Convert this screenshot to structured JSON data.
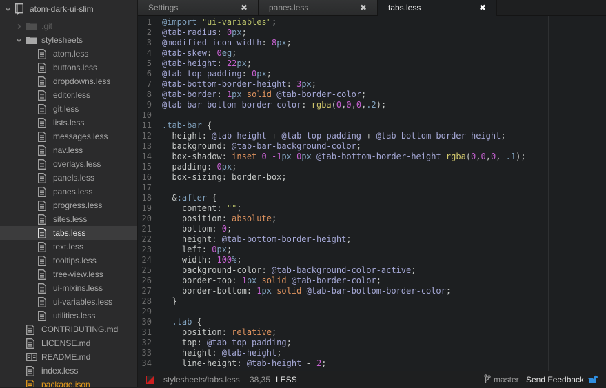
{
  "sidebar": {
    "root": {
      "label": "atom-dark-ui-slim",
      "icon": "repo-icon",
      "expanded": true
    },
    "items": [
      {
        "label": ".git",
        "type": "folder",
        "depth": 1,
        "expanded": false,
        "dim": true
      },
      {
        "label": "stylesheets",
        "type": "folder",
        "depth": 1,
        "expanded": true
      },
      {
        "label": "atom.less",
        "type": "file",
        "depth": 2
      },
      {
        "label": "buttons.less",
        "type": "file",
        "depth": 2
      },
      {
        "label": "dropdowns.less",
        "type": "file",
        "depth": 2
      },
      {
        "label": "editor.less",
        "type": "file",
        "depth": 2
      },
      {
        "label": "git.less",
        "type": "file",
        "depth": 2
      },
      {
        "label": "lists.less",
        "type": "file",
        "depth": 2
      },
      {
        "label": "messages.less",
        "type": "file",
        "depth": 2
      },
      {
        "label": "nav.less",
        "type": "file",
        "depth": 2
      },
      {
        "label": "overlays.less",
        "type": "file",
        "depth": 2
      },
      {
        "label": "panels.less",
        "type": "file",
        "depth": 2
      },
      {
        "label": "panes.less",
        "type": "file",
        "depth": 2
      },
      {
        "label": "progress.less",
        "type": "file",
        "depth": 2
      },
      {
        "label": "sites.less",
        "type": "file",
        "depth": 2
      },
      {
        "label": "tabs.less",
        "type": "file",
        "depth": 2,
        "selected": true
      },
      {
        "label": "text.less",
        "type": "file",
        "depth": 2
      },
      {
        "label": "tooltips.less",
        "type": "file",
        "depth": 2
      },
      {
        "label": "tree-view.less",
        "type": "file",
        "depth": 2
      },
      {
        "label": "ui-mixins.less",
        "type": "file",
        "depth": 2
      },
      {
        "label": "ui-variables.less",
        "type": "file",
        "depth": 2
      },
      {
        "label": "utilities.less",
        "type": "file",
        "depth": 2
      },
      {
        "label": "CONTRIBUTING.md",
        "type": "file",
        "depth": 1
      },
      {
        "label": "LICENSE.md",
        "type": "file",
        "depth": 1
      },
      {
        "label": "README.md",
        "type": "book",
        "depth": 1
      },
      {
        "label": "index.less",
        "type": "file",
        "depth": 1
      },
      {
        "label": "package.json",
        "type": "file-modified",
        "depth": 1
      }
    ]
  },
  "tabs": [
    {
      "label": "Settings",
      "close": "✖",
      "active": false
    },
    {
      "label": "panes.less",
      "close": "✖",
      "active": false
    },
    {
      "label": "tabs.less",
      "close": "✖",
      "active": true
    }
  ],
  "editor": {
    "lines": [
      {
        "n": "1",
        "tokens": [
          [
            "imp",
            "@import"
          ],
          [
            "txt",
            " "
          ],
          [
            "str",
            "\"ui-variables\""
          ],
          [
            "txt",
            ";"
          ]
        ]
      },
      {
        "n": "2",
        "tokens": [
          [
            "var",
            "@tab-radius"
          ],
          [
            "txt",
            ": "
          ],
          [
            "num",
            "0"
          ],
          [
            "unit",
            "px"
          ],
          [
            "txt",
            ";"
          ]
        ]
      },
      {
        "n": "3",
        "tokens": [
          [
            "var",
            "@modified-icon-width"
          ],
          [
            "txt",
            ": "
          ],
          [
            "num",
            "8"
          ],
          [
            "unit",
            "px"
          ],
          [
            "txt",
            ";"
          ]
        ]
      },
      {
        "n": "4",
        "tokens": [
          [
            "var",
            "@tab-skew"
          ],
          [
            "txt",
            ": "
          ],
          [
            "num",
            "0"
          ],
          [
            "unit",
            "eg"
          ],
          [
            "txt",
            ";"
          ]
        ]
      },
      {
        "n": "5",
        "tokens": [
          [
            "var",
            "@tab-height"
          ],
          [
            "txt",
            ": "
          ],
          [
            "num",
            "22"
          ],
          [
            "unit",
            "px"
          ],
          [
            "txt",
            ";"
          ]
        ]
      },
      {
        "n": "6",
        "tokens": [
          [
            "var",
            "@tab-top-padding"
          ],
          [
            "txt",
            ": "
          ],
          [
            "num",
            "0"
          ],
          [
            "unit",
            "px"
          ],
          [
            "txt",
            ";"
          ]
        ]
      },
      {
        "n": "7",
        "tokens": [
          [
            "var",
            "@tab-bottom-border-height"
          ],
          [
            "txt",
            ": "
          ],
          [
            "num",
            "3"
          ],
          [
            "unit",
            "px"
          ],
          [
            "txt",
            ";"
          ]
        ]
      },
      {
        "n": "8",
        "tokens": [
          [
            "var",
            "@tab-border"
          ],
          [
            "txt",
            ": "
          ],
          [
            "num",
            "1"
          ],
          [
            "unit",
            "px"
          ],
          [
            "txt",
            " "
          ],
          [
            "kw",
            "solid"
          ],
          [
            "txt",
            " "
          ],
          [
            "var",
            "@tab-border-color"
          ],
          [
            "txt",
            ";"
          ]
        ]
      },
      {
        "n": "9",
        "tokens": [
          [
            "var",
            "@tab-bar-bottom-border-color"
          ],
          [
            "txt",
            ": "
          ],
          [
            "fn",
            "rgba"
          ],
          [
            "txt",
            "("
          ],
          [
            "num",
            "0"
          ],
          [
            "txt",
            ","
          ],
          [
            "num",
            "0"
          ],
          [
            "txt",
            ","
          ],
          [
            "num",
            "0"
          ],
          [
            "txt",
            ","
          ],
          [
            "unit",
            ".2"
          ],
          [
            "txt",
            ");"
          ]
        ]
      },
      {
        "n": "10",
        "tokens": []
      },
      {
        "n": "11",
        "tokens": [
          [
            "sel",
            ".tab-bar"
          ],
          [
            "txt",
            " {"
          ]
        ]
      },
      {
        "n": "12",
        "tokens": [
          [
            "txt",
            "  height: "
          ],
          [
            "var",
            "@tab-height"
          ],
          [
            "txt",
            " + "
          ],
          [
            "var",
            "@tab-top-padding"
          ],
          [
            "txt",
            " + "
          ],
          [
            "var",
            "@tab-bottom-border-height"
          ],
          [
            "txt",
            ";"
          ]
        ]
      },
      {
        "n": "13",
        "tokens": [
          [
            "txt",
            "  background: "
          ],
          [
            "var",
            "@tab-bar-background-color"
          ],
          [
            "txt",
            ";"
          ]
        ]
      },
      {
        "n": "14",
        "tokens": [
          [
            "txt",
            "  box-shadow: "
          ],
          [
            "kw",
            "inset"
          ],
          [
            "txt",
            " "
          ],
          [
            "num",
            "0"
          ],
          [
            "txt",
            " "
          ],
          [
            "num",
            "-1"
          ],
          [
            "unit",
            "px"
          ],
          [
            "txt",
            " "
          ],
          [
            "num",
            "0"
          ],
          [
            "unit",
            "px"
          ],
          [
            "txt",
            " "
          ],
          [
            "var",
            "@tab-bottom-border-height"
          ],
          [
            "txt",
            " "
          ],
          [
            "fn",
            "rgba"
          ],
          [
            "txt",
            "("
          ],
          [
            "num",
            "0"
          ],
          [
            "txt",
            ","
          ],
          [
            "num",
            "0"
          ],
          [
            "txt",
            ","
          ],
          [
            "num",
            "0"
          ],
          [
            "txt",
            ", "
          ],
          [
            "unit",
            ".1"
          ],
          [
            "txt",
            ");"
          ]
        ]
      },
      {
        "n": "15",
        "tokens": [
          [
            "txt",
            "  padding: "
          ],
          [
            "num",
            "0"
          ],
          [
            "unit",
            "px"
          ],
          [
            "txt",
            ";"
          ]
        ]
      },
      {
        "n": "16",
        "tokens": [
          [
            "txt",
            "  box-sizing: border-box;"
          ]
        ]
      },
      {
        "n": "17",
        "tokens": []
      },
      {
        "n": "18",
        "tokens": [
          [
            "txt",
            "  &"
          ],
          [
            "sel",
            ":after"
          ],
          [
            "txt",
            " {"
          ]
        ]
      },
      {
        "n": "19",
        "tokens": [
          [
            "txt",
            "    content: "
          ],
          [
            "str",
            "\"\""
          ],
          [
            "txt",
            ";"
          ]
        ]
      },
      {
        "n": "20",
        "tokens": [
          [
            "txt",
            "    position: "
          ],
          [
            "kw",
            "absolute"
          ],
          [
            "txt",
            ";"
          ]
        ]
      },
      {
        "n": "21",
        "tokens": [
          [
            "txt",
            "    bottom: "
          ],
          [
            "num",
            "0"
          ],
          [
            "txt",
            ";"
          ]
        ]
      },
      {
        "n": "22",
        "tokens": [
          [
            "txt",
            "    height: "
          ],
          [
            "var",
            "@tab-bottom-border-height"
          ],
          [
            "txt",
            ";"
          ]
        ]
      },
      {
        "n": "23",
        "tokens": [
          [
            "txt",
            "    left: "
          ],
          [
            "num",
            "0"
          ],
          [
            "unit",
            "px"
          ],
          [
            "txt",
            ";"
          ]
        ]
      },
      {
        "n": "24",
        "tokens": [
          [
            "txt",
            "    width: "
          ],
          [
            "num",
            "100"
          ],
          [
            "unit",
            "%"
          ],
          [
            "txt",
            ";"
          ]
        ]
      },
      {
        "n": "25",
        "tokens": [
          [
            "txt",
            "    background-color: "
          ],
          [
            "var",
            "@tab-background-color-active"
          ],
          [
            "txt",
            ";"
          ]
        ]
      },
      {
        "n": "26",
        "tokens": [
          [
            "txt",
            "    border-top: "
          ],
          [
            "num",
            "1"
          ],
          [
            "unit",
            "px"
          ],
          [
            "txt",
            " "
          ],
          [
            "kw",
            "solid"
          ],
          [
            "txt",
            " "
          ],
          [
            "var",
            "@tab-border-color"
          ],
          [
            "txt",
            ";"
          ]
        ]
      },
      {
        "n": "27",
        "tokens": [
          [
            "txt",
            "    border-bottom: "
          ],
          [
            "num",
            "1"
          ],
          [
            "unit",
            "px"
          ],
          [
            "txt",
            " "
          ],
          [
            "kw",
            "solid"
          ],
          [
            "txt",
            " "
          ],
          [
            "var",
            "@tab-bar-bottom-border-color"
          ],
          [
            "txt",
            ";"
          ]
        ]
      },
      {
        "n": "28",
        "tokens": [
          [
            "txt",
            "  }"
          ]
        ]
      },
      {
        "n": "29",
        "tokens": []
      },
      {
        "n": "30",
        "tokens": [
          [
            "txt",
            "  "
          ],
          [
            "sel",
            ".tab"
          ],
          [
            "txt",
            " {"
          ]
        ]
      },
      {
        "n": "31",
        "tokens": [
          [
            "txt",
            "    position: "
          ],
          [
            "kw",
            "relative"
          ],
          [
            "txt",
            ";"
          ]
        ]
      },
      {
        "n": "32",
        "tokens": [
          [
            "txt",
            "    top: "
          ],
          [
            "var",
            "@tab-top-padding"
          ],
          [
            "txt",
            ";"
          ]
        ]
      },
      {
        "n": "33",
        "tokens": [
          [
            "txt",
            "    height: "
          ],
          [
            "var",
            "@tab-height"
          ],
          [
            "txt",
            ";"
          ]
        ]
      },
      {
        "n": "34",
        "tokens": [
          [
            "txt",
            "    line-height: "
          ],
          [
            "var",
            "@tab-height"
          ],
          [
            "txt",
            " - "
          ],
          [
            "num",
            "2"
          ],
          [
            "txt",
            ";"
          ]
        ]
      }
    ]
  },
  "statusbar": {
    "file_path": "stylesheets/tabs.less",
    "cursor": "38,35",
    "grammar": "LESS",
    "branch": "master",
    "feedback": "Send Feedback",
    "colors": {
      "modified_indicator": "#cc1f1f",
      "feedback_icon": "#2f8ee0"
    }
  }
}
